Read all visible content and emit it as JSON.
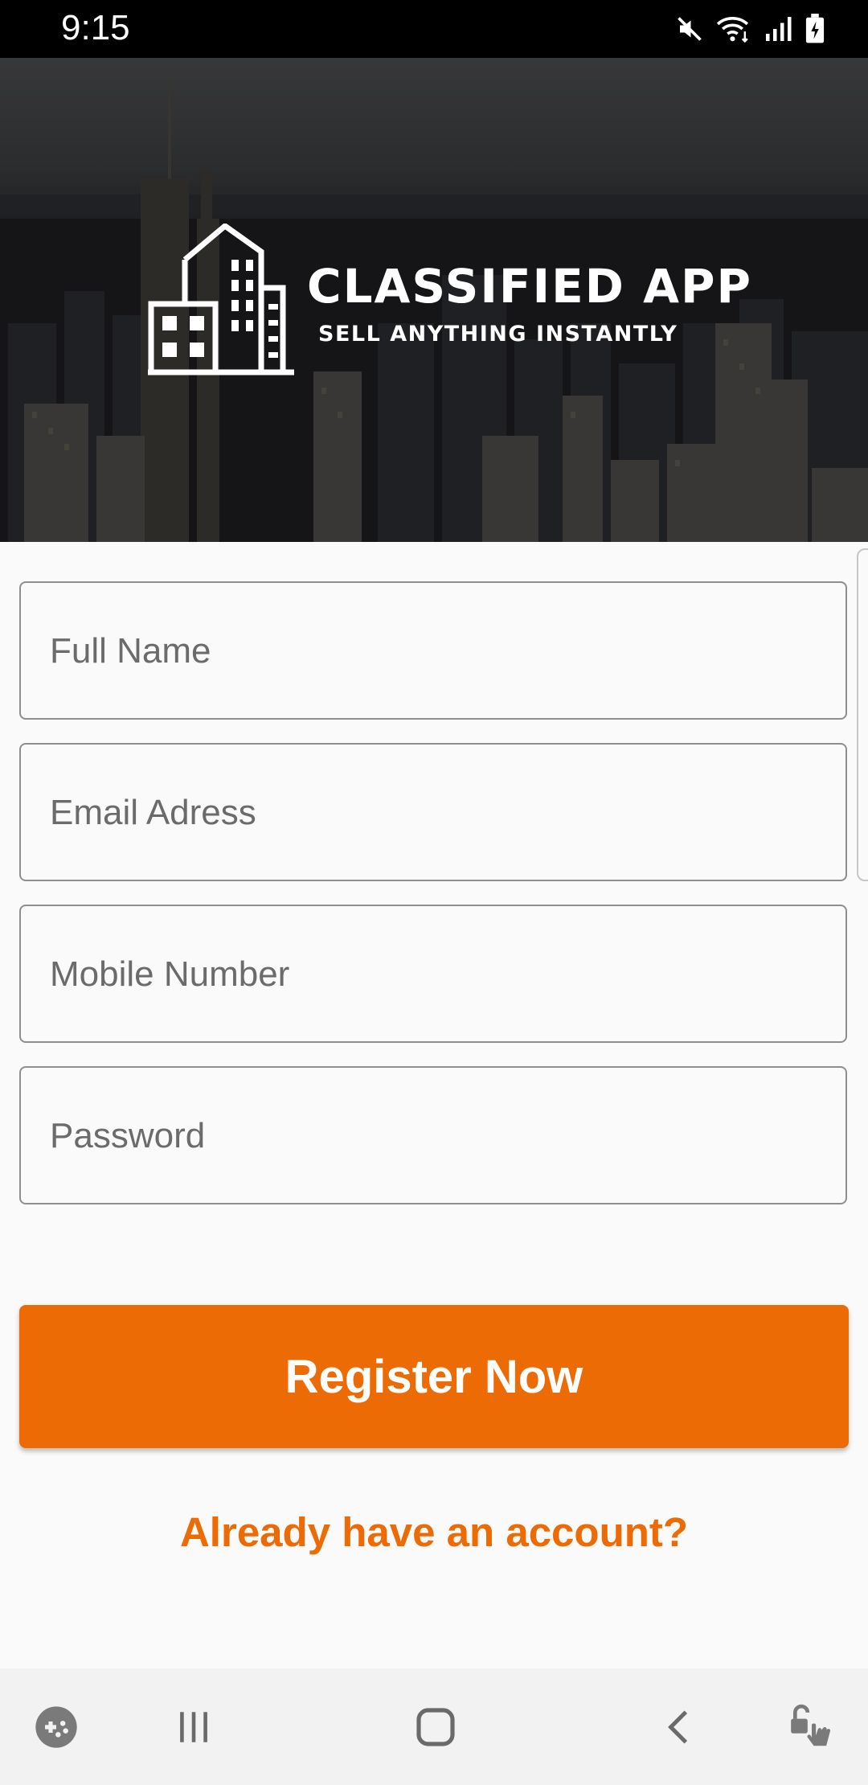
{
  "status_bar": {
    "time": "9:15",
    "icons": [
      "mute-icon",
      "wifi-icon",
      "signal-icon",
      "battery-icon"
    ]
  },
  "hero": {
    "app_name": "CLASSIFIED APP",
    "tagline": "SELL ANYTHING INSTANTLY",
    "logo_icon": "buildings-icon"
  },
  "form": {
    "full_name": {
      "placeholder": "Full Name",
      "value": ""
    },
    "email": {
      "placeholder": "Email Adress",
      "value": ""
    },
    "mobile": {
      "placeholder": "Mobile Number",
      "value": ""
    },
    "password": {
      "placeholder": "Password",
      "value": ""
    }
  },
  "actions": {
    "register_label": "Register Now",
    "login_link": "Already have an account?"
  },
  "nav_bar": {
    "icons": [
      "game-launcher-icon",
      "recents-icon",
      "home-icon",
      "back-icon",
      "unlock-icon"
    ]
  },
  "colors": {
    "accent": "#ec6b05",
    "background": "#fafafa",
    "field_border": "#8e8e8e"
  }
}
